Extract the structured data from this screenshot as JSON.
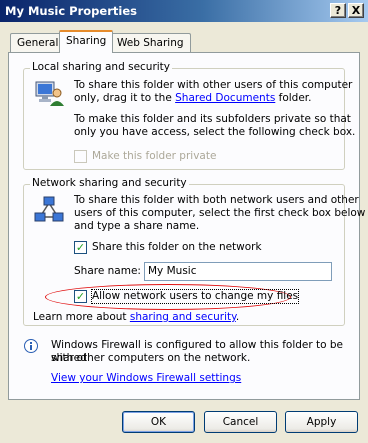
{
  "window": {
    "title": "My Music Properties",
    "help_button": "?",
    "close_button": "X"
  },
  "tabs": [
    {
      "label": "General"
    },
    {
      "label": "Sharing"
    },
    {
      "label": "Web Sharing"
    }
  ],
  "local_group": {
    "legend": "Local sharing and security",
    "para1_line1": "To share this folder with other users of this computer",
    "para1_line2_prefix": "only, drag it to the ",
    "para1_link": "Shared Documents",
    "para1_line2_suffix": " folder.",
    "para2_line1": "To make this folder and its subfolders private so that",
    "para2_line2": "only you have access, select the following check box.",
    "private_checkbox_label": "Make this folder private",
    "private_checked": false
  },
  "network_group": {
    "legend": "Network sharing and security",
    "para_line1": "To share this folder with both network users and other",
    "para_line2": "users of this computer, select the first check box below",
    "para_line3": "and type a share name.",
    "share_checkbox_label": "Share this folder on the network",
    "share_checked": true,
    "share_name_label": "Share name:",
    "share_name_value": "My Music",
    "allow_checkbox_label": "Allow network users to change my files",
    "allow_checked": true,
    "learn_more_prefix": "Learn more about ",
    "learn_more_link": "sharing and security",
    "learn_more_suffix": "."
  },
  "firewall": {
    "line1": "Windows Firewall is configured to allow this folder to be shared",
    "line2": "with other computers on the network.",
    "link": "View your Windows Firewall settings"
  },
  "buttons": {
    "ok": "OK",
    "cancel": "Cancel",
    "apply": "Apply"
  },
  "colors": {
    "titlebar": "#0a246a",
    "dialog_bg": "#ece9d8",
    "link": "#0000ff",
    "highlight_oval": "#e01010"
  }
}
